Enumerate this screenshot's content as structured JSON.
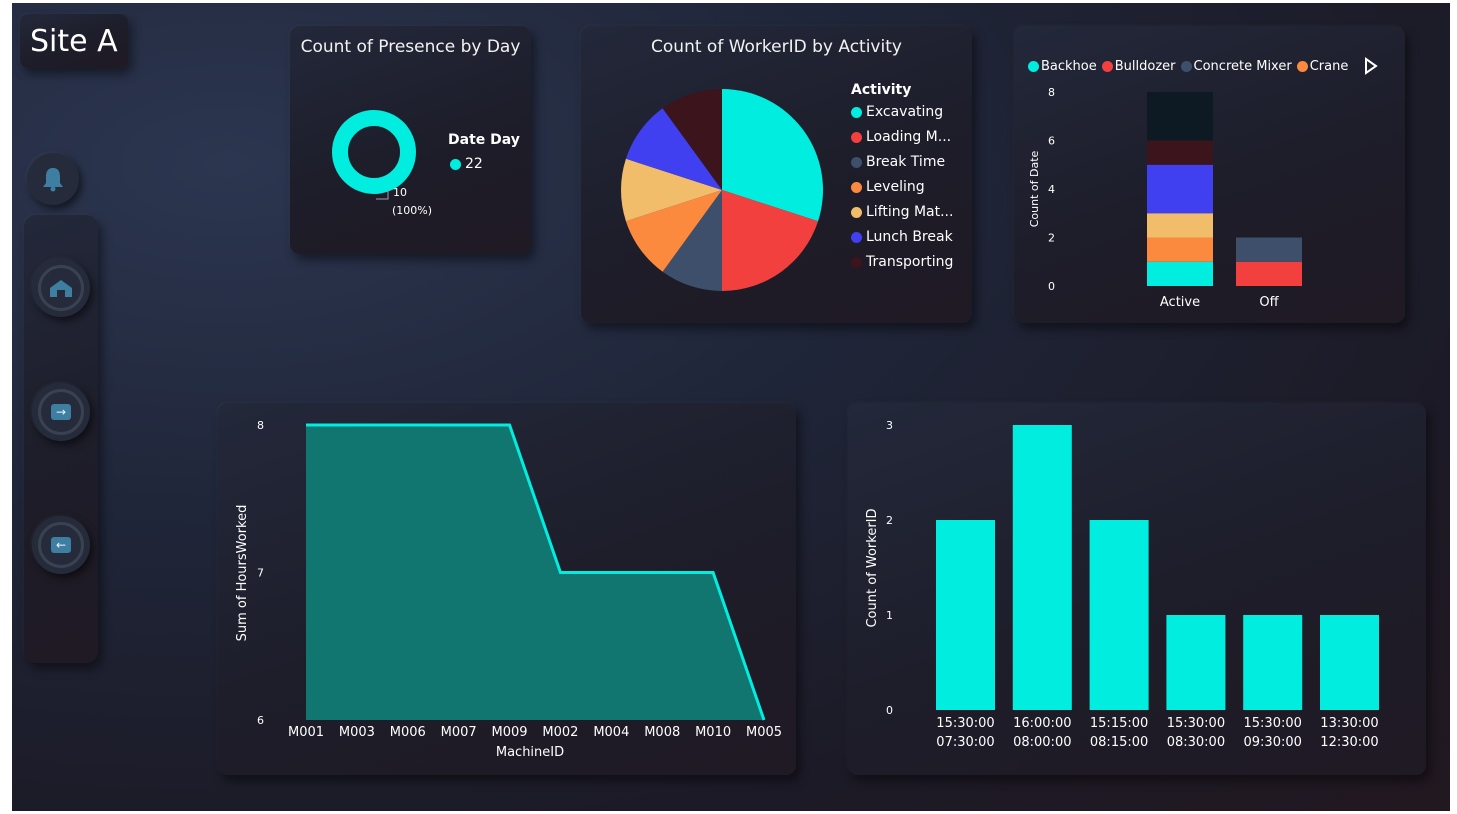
{
  "page": {
    "title": "Site A"
  },
  "nav": {
    "arrow_right": "→",
    "arrow_left": "←"
  },
  "colors": {
    "teal": "#00ede0",
    "red": "#f2403f",
    "slate": "#3d4f6b",
    "orange": "#fb8a3e",
    "sand": "#f2bd6b",
    "blue": "#4040f0",
    "maroon": "#3b141c",
    "navy": "#0d1a24"
  },
  "presence": {
    "title": "Count of Presence by Day",
    "legend_title": "Date Day",
    "legend_item": "22",
    "value_label": "10",
    "pct_label": "(100%)"
  },
  "activity": {
    "title": "Count of WorkerID by Activity",
    "legend_title": "Activity",
    "legend": [
      "Excavating",
      "Loading M...",
      "Break Time",
      "Leveling",
      "Lifting Mat...",
      "Lunch Break",
      "Transporting"
    ]
  },
  "machine_legend": {
    "items": [
      "Backhoe",
      "Bulldozer",
      "Concrete Mixer",
      "Crane"
    ],
    "next_icon": "play-triangle"
  },
  "chart_data": [
    {
      "type": "pie",
      "variant": "donut",
      "title": "Count of Presence by Day",
      "legend_title": "Date Day",
      "labels": [
        "22"
      ],
      "values": [
        10
      ],
      "percent": [
        "100%"
      ]
    },
    {
      "type": "pie",
      "title": "Count of WorkerID by Activity",
      "legend_title": "Activity",
      "labels": [
        "Excavating",
        "Loading M...",
        "Break Time",
        "Leveling",
        "Lifting Mat...",
        "Lunch Break",
        "Transporting"
      ],
      "values": [
        3,
        2,
        1,
        1,
        1,
        1,
        1
      ]
    },
    {
      "type": "bar",
      "stacked": true,
      "ylabel": "Count of Date",
      "categories": [
        "Active",
        "Off"
      ],
      "yticks": [
        "0",
        "2",
        "4",
        "6",
        "8"
      ],
      "ylim": [
        0,
        8
      ],
      "series": [
        {
          "values": [
            1,
            0
          ]
        },
        {
          "values": [
            0,
            1
          ]
        },
        {
          "values": [
            0,
            1
          ]
        },
        {
          "values": [
            1,
            0
          ]
        },
        {
          "values": [
            1,
            0
          ]
        },
        {
          "values": [
            2,
            0
          ]
        },
        {
          "values": [
            1,
            0
          ]
        },
        {
          "values": [
            2,
            0
          ]
        }
      ]
    },
    {
      "type": "area",
      "xlabel": "MachineID",
      "ylabel": "Sum of HoursWorked",
      "categories": [
        "M001",
        "M003",
        "M006",
        "M007",
        "M009",
        "M002",
        "M004",
        "M008",
        "M010",
        "M005"
      ],
      "values": [
        8,
        8,
        8,
        8,
        8,
        7,
        7,
        7,
        7,
        6
      ],
      "yticks": [
        "6",
        "7",
        "8"
      ],
      "ylim": [
        6,
        8
      ]
    },
    {
      "type": "bar",
      "ylabel": "Count of WorkerID",
      "categories": [
        [
          "15:30:00",
          "07:30:00"
        ],
        [
          "16:00:00",
          "08:00:00"
        ],
        [
          "15:15:00",
          "08:15:00"
        ],
        [
          "15:30:00",
          "08:30:00"
        ],
        [
          "15:30:00",
          "09:30:00"
        ],
        [
          "13:30:00",
          "12:30:00"
        ]
      ],
      "values": [
        2,
        3,
        2,
        1,
        1,
        1
      ],
      "yticks": [
        "0",
        "1",
        "2",
        "3"
      ],
      "ylim": [
        0,
        3
      ]
    }
  ]
}
